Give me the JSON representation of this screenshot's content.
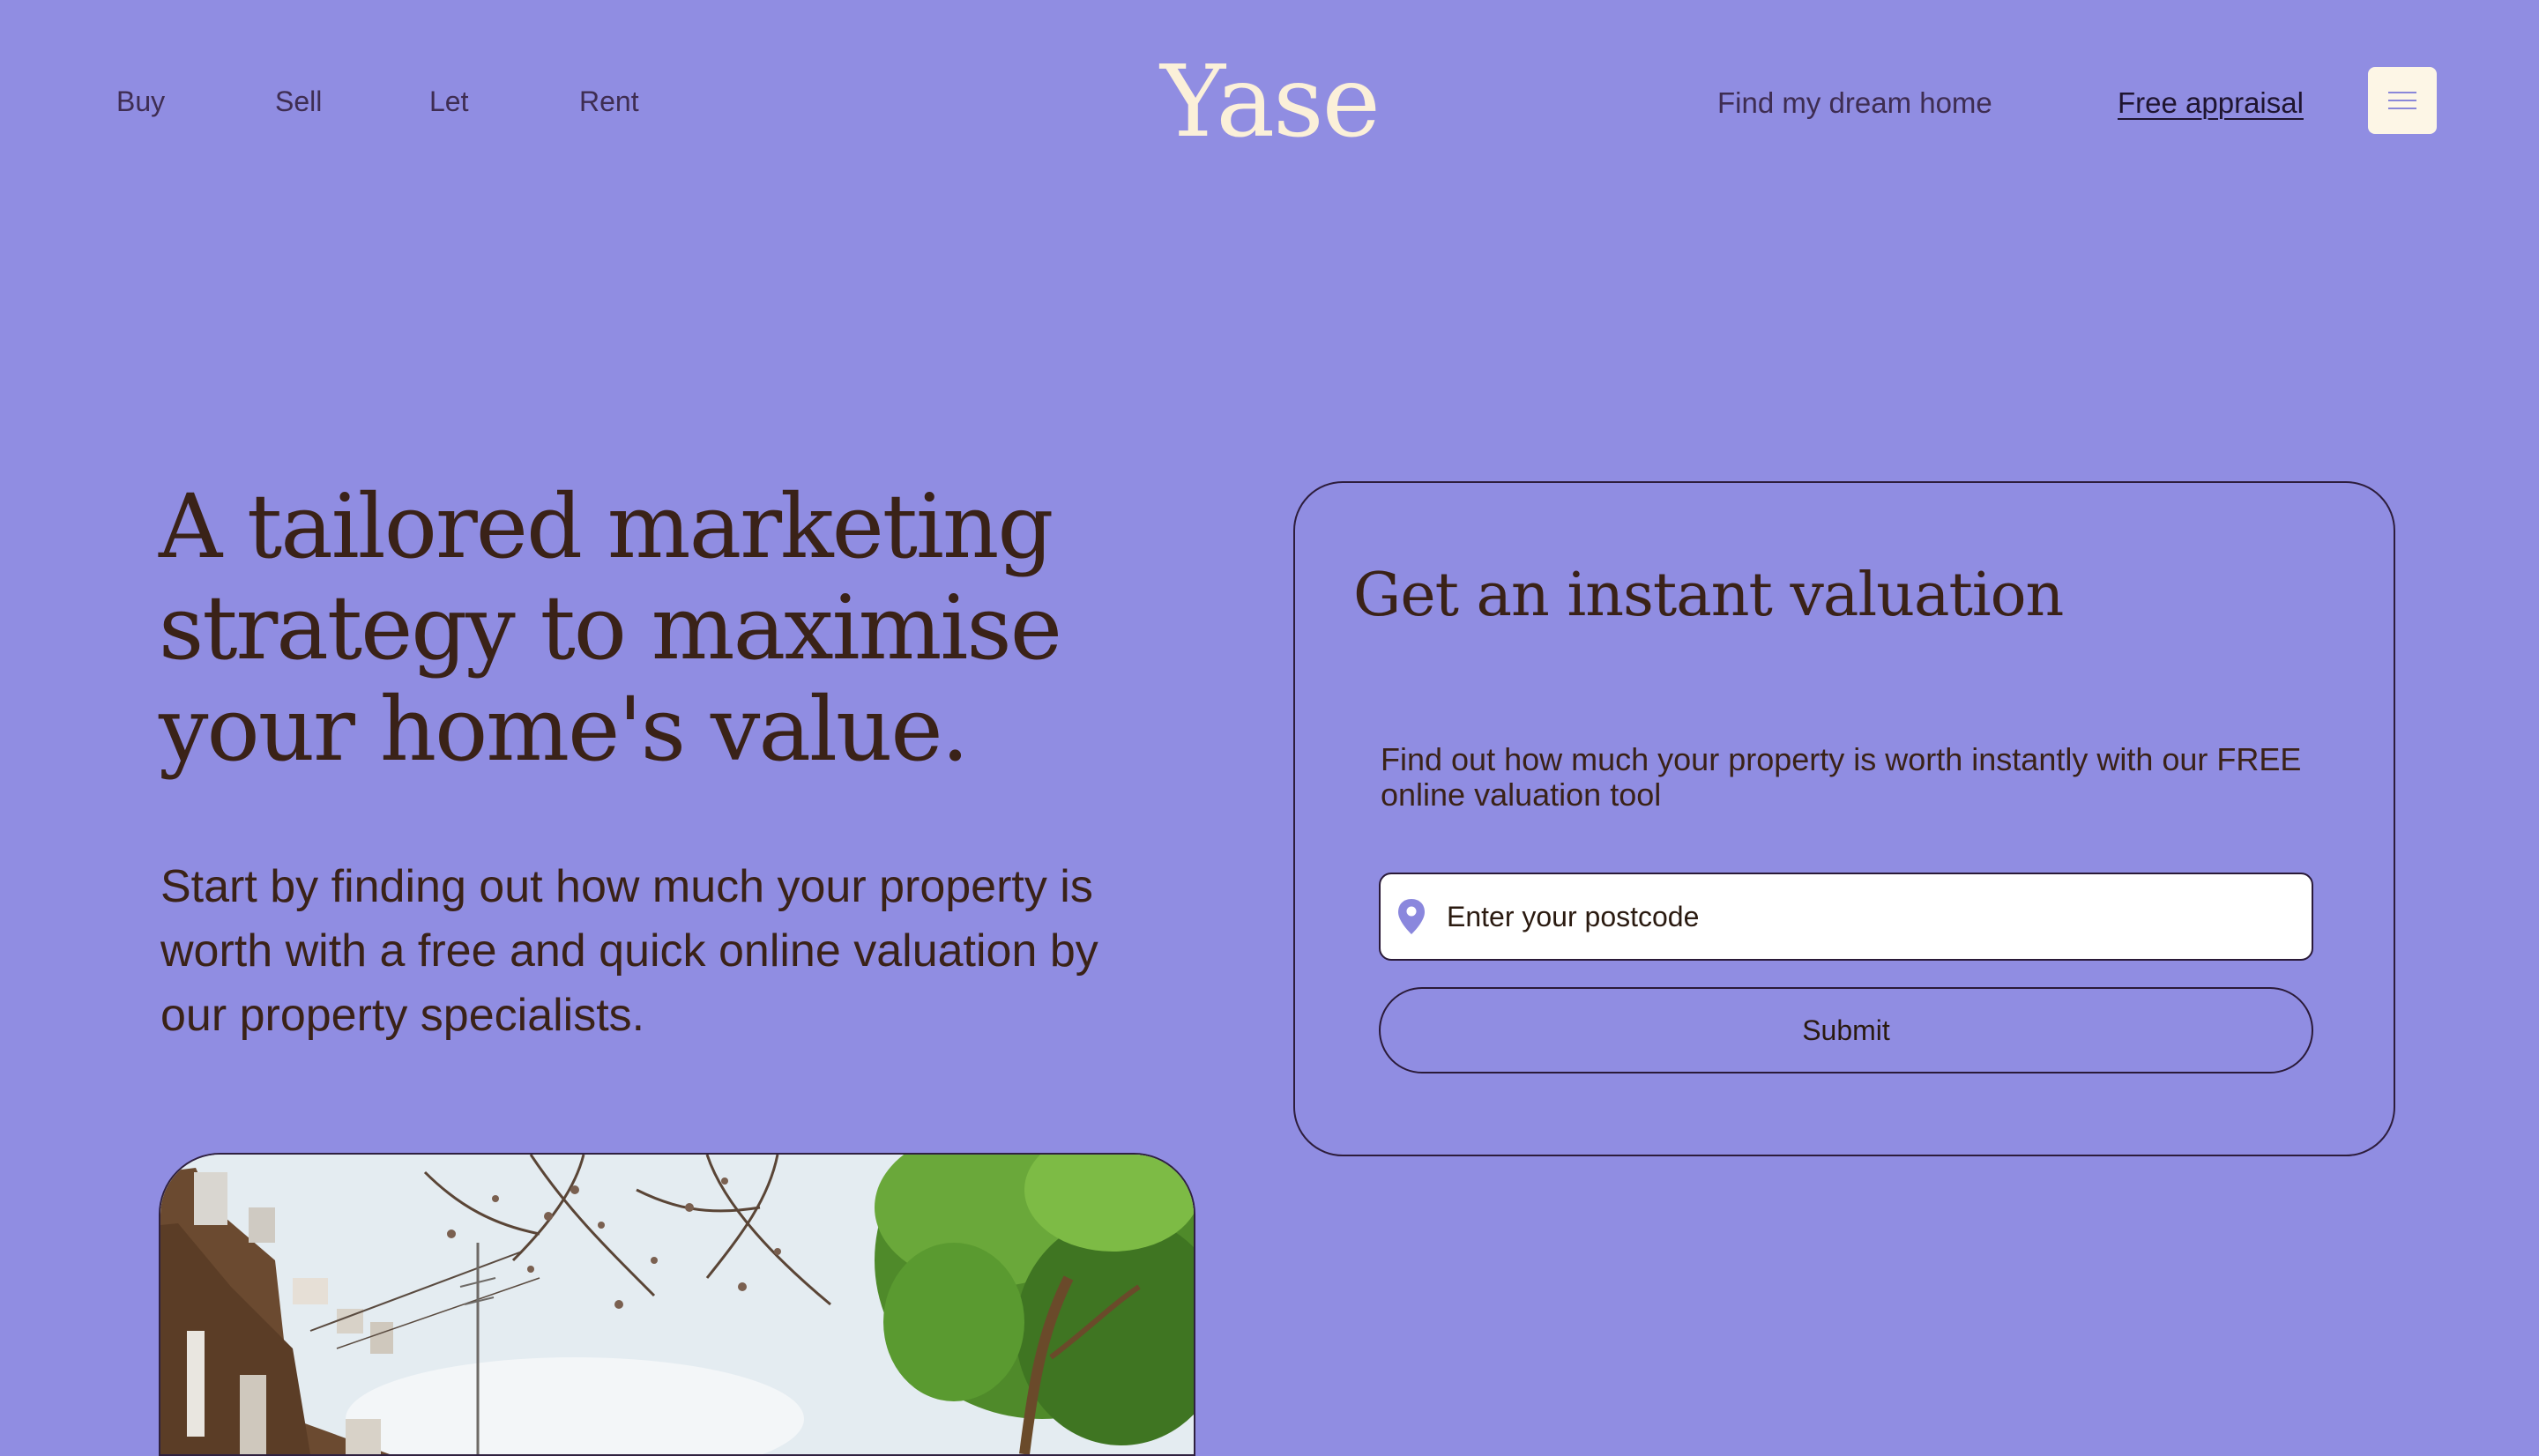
{
  "nav": {
    "left": [
      "Buy",
      "Sell",
      "Let",
      "Rent"
    ],
    "logo": "Yase",
    "right": {
      "find_home": "Find my dream home",
      "free_appraisal": "Free appraisal"
    },
    "menu_icon": "hamburger-menu-icon"
  },
  "hero": {
    "title": "A tailored marketing strategy to maximise your home's value.",
    "subtitle": "Start by finding out how much your property is worth with a free and quick online valuation by our property specialists.",
    "image_description_icon": "street-photo"
  },
  "valuation": {
    "title": "Get an instant valuation",
    "description": "Find out how much your property is worth instantly with our FREE online valuation tool",
    "postcode_placeholder": "Enter your postcode",
    "postcode_value": "",
    "location_icon": "location-pin-icon",
    "submit_label": "Submit"
  },
  "colors": {
    "background": "#908de2",
    "logo": "#fbf0d9",
    "text_dark": "#3a2218",
    "menu_button": "#fdf6e6"
  }
}
